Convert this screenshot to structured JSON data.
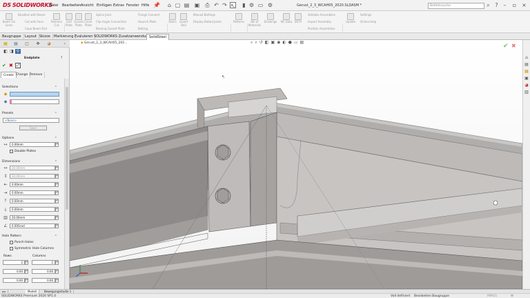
{
  "app": {
    "brand": "SOLIDWORKS",
    "document_title": "Gerust_2_3_WCAH05_2020.SLDASM *",
    "search_placeholder": "Befehlssuche"
  },
  "menu": [
    "Datei",
    "Bearbeiten",
    "Ansicht",
    "Einfügen",
    "Extras",
    "Fenster",
    "Hilfe"
  ],
  "ribbon": {
    "large_buttons": [
      {
        "label": "Beam On Lines"
      },
      {
        "label": "Beam"
      },
      {
        "label": "Remove Cut"
      },
      {
        "label": "End Plate"
      },
      {
        "label": "Gusset Plate"
      },
      {
        "label": "Cover Plate"
      },
      {
        "label": "Stiffener"
      },
      {
        "label": "Bolt"
      },
      {
        "label": "Stairs"
      },
      {
        "label": "Guard Rail"
      },
      {
        "label": "Patterns"
      },
      {
        "label": "Bill of Materials"
      },
      {
        "label": "Drawings"
      },
      {
        "label": "NC Data"
      },
      {
        "label": "DSTV"
      },
      {
        "label": "Update"
      }
    ],
    "small_buttons": [
      "Cut with Beam",
      "Cut with Face",
      "Cope Beam End",
      "Splice Joint",
      "Clip Angle Connection",
      "Beam Brace",
      "Haunch Plate",
      "Bearing Gusset Plate",
      "Flange Connect",
      "Bolting",
      "Manual Boltings",
      "Display Bolted Joints",
      "Validate Assemblies",
      "Import Assembly",
      "Position Assemblies",
      "Settings",
      "Online Help"
    ]
  },
  "tabs": [
    {
      "label": "Baugruppe",
      "active": false
    },
    {
      "label": "Layout",
      "active": false
    },
    {
      "label": "Skizze",
      "active": false
    },
    {
      "label": "Markierung",
      "active": false
    },
    {
      "label": "Evaluieren",
      "active": false
    },
    {
      "label": "SOLIDWORKS Zusatzanwendungen",
      "active": false
    },
    {
      "label": "SolidSteel",
      "active": true
    }
  ],
  "feature_tree_item": "Gerust_2_3_WCAH05_202...",
  "panel": {
    "title": "Endplate",
    "subtabs": [
      {
        "label": "Create",
        "active": true
      },
      {
        "label": "Change",
        "active": false
      },
      {
        "label": "Remove",
        "active": false
      }
    ],
    "sections": {
      "selections": "Selections",
      "presets": "Presets",
      "options": "Options",
      "dimensions": "Dimensions",
      "hole_pattern": "Hole Pattern"
    },
    "presets_value": "<None>",
    "save_label": "Save",
    "options_value": "0.00mm",
    "double_plates_label": "Double Plates",
    "dimensions": [
      {
        "value": "30.00mm",
        "disabled": true
      },
      {
        "value": "34.00mm",
        "disabled": true
      },
      {
        "value": "0.00mm",
        "disabled": false
      },
      {
        "value": "0.00mm",
        "disabled": false
      },
      {
        "value": "0.00mm",
        "disabled": false
      },
      {
        "value": "0.00mm",
        "disabled": false
      },
      {
        "value": "20.00mm",
        "disabled": false
      },
      {
        "value": "0.00Grad",
        "disabled": false
      }
    ],
    "punch_holes_label": "Punch Holes",
    "symmetric_label": "Symmetric Hole Columns",
    "rows_label": "Rows",
    "columns_label": "Columns",
    "rows_value": "2",
    "columns_value": "2",
    "row_dim": "0.00",
    "col_dim": "0.00",
    "row_dim2": "0.00",
    "col_dim2": "0.00"
  },
  "bottom_tabs": [
    {
      "label": "Modell",
      "active": true
    },
    {
      "label": "Bewegungsstudie 1",
      "active": false
    }
  ],
  "status": {
    "version": "SOLIDWORKS Premium 2020 SP1.0",
    "defined": "Voll definiert",
    "editing": "Bearbeiten Baugruppe",
    "units": "MMGS"
  }
}
